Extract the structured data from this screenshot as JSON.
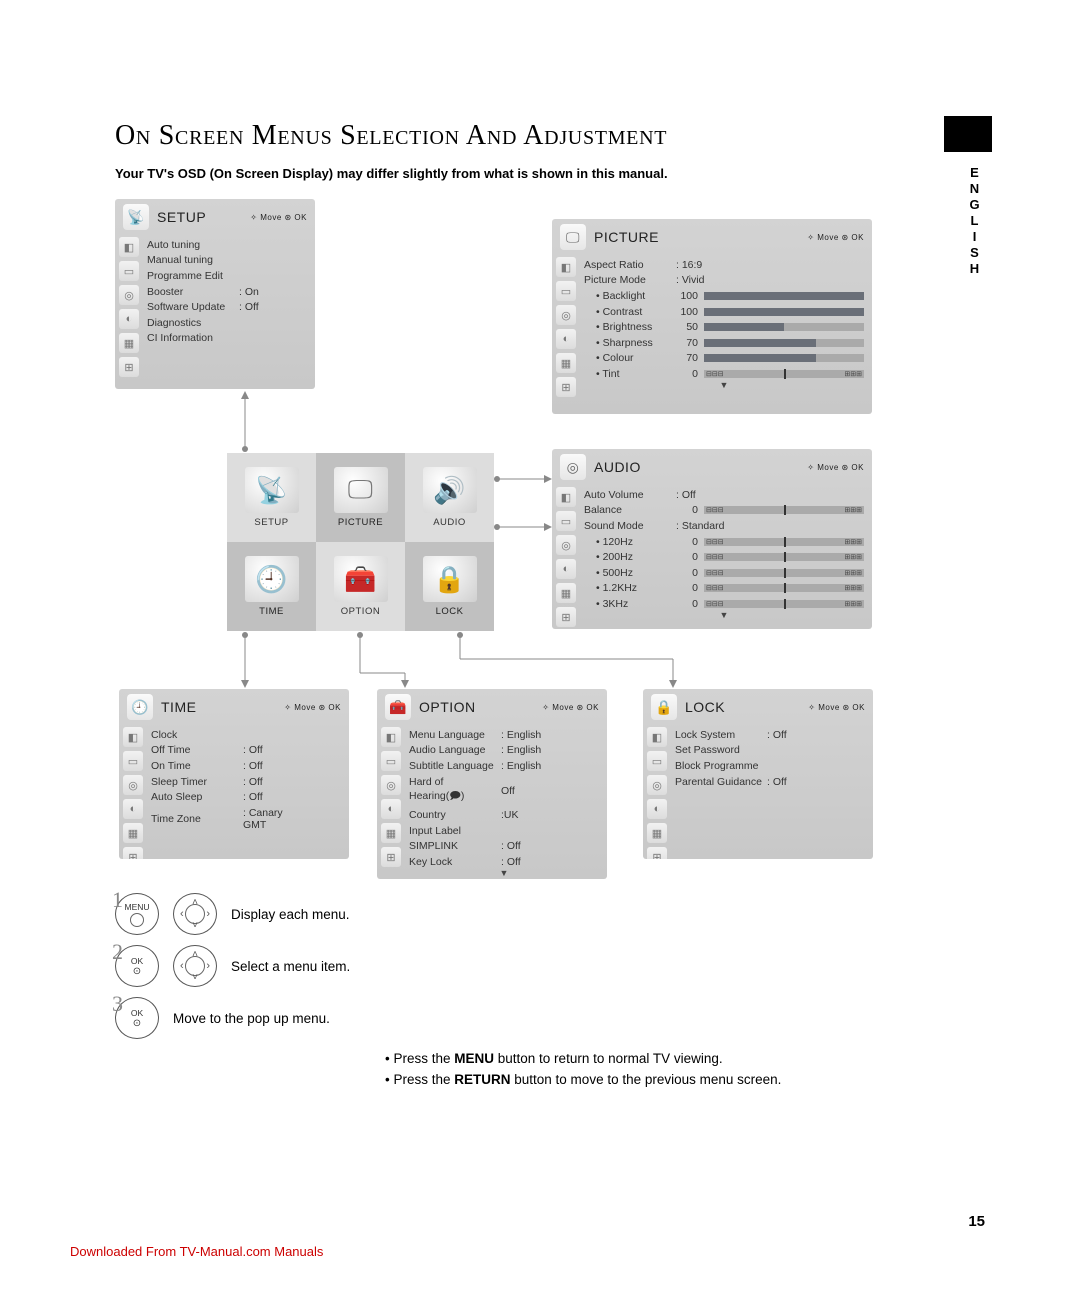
{
  "title": "On Screen Menus Selection And Adjustment",
  "subtitle": "Your TV's OSD (On Screen Display) may differ slightly from what is shown in this manual.",
  "side_lang": "ENGLISH",
  "panel_hint": "✧ Move   ⊛ OK",
  "panels": {
    "setup": {
      "title": "SETUP",
      "items": [
        {
          "label": "Auto tuning",
          "value": ""
        },
        {
          "label": "Manual tuning",
          "value": ""
        },
        {
          "label": "Programme Edit",
          "value": ""
        },
        {
          "label": "Booster",
          "value": ": On"
        },
        {
          "label": "Software Update",
          "value": ": Off"
        },
        {
          "label": "Diagnostics",
          "value": ""
        },
        {
          "label": "CI Information",
          "value": ""
        }
      ]
    },
    "picture": {
      "title": "PICTURE",
      "items": [
        {
          "label": "Aspect Ratio",
          "value": ": 16:9"
        },
        {
          "label": "Picture Mode",
          "value": ": Vivid"
        }
      ],
      "sub": [
        {
          "label": "Backlight",
          "value": "100",
          "pct": 100,
          "type": "bar"
        },
        {
          "label": "Contrast",
          "value": "100",
          "pct": 100,
          "type": "bar"
        },
        {
          "label": "Brightness",
          "value": "50",
          "pct": 50,
          "type": "bar"
        },
        {
          "label": "Sharpness",
          "value": "70",
          "pct": 70,
          "type": "bar"
        },
        {
          "label": "Colour",
          "value": "70",
          "pct": 70,
          "type": "bar"
        },
        {
          "label": "Tint",
          "value": "0",
          "type": "slider"
        }
      ]
    },
    "audio": {
      "title": "AUDIO",
      "items": [
        {
          "label": "Auto Volume",
          "value": ": Off"
        },
        {
          "label": "Balance",
          "value": "0",
          "type": "slider"
        },
        {
          "label": "Sound Mode",
          "value": ": Standard"
        }
      ],
      "sub": [
        {
          "label": "120Hz",
          "value": "0",
          "type": "slider"
        },
        {
          "label": "200Hz",
          "value": "0",
          "type": "slider"
        },
        {
          "label": "500Hz",
          "value": "0",
          "type": "slider"
        },
        {
          "label": "1.2KHz",
          "value": "0",
          "type": "slider"
        },
        {
          "label": "3KHz",
          "value": "0",
          "type": "slider"
        }
      ]
    },
    "time": {
      "title": "TIME",
      "items": [
        {
          "label": "Clock",
          "value": ""
        },
        {
          "label": "Off Time",
          "value": ": Off"
        },
        {
          "label": "On Time",
          "value": ": Off"
        },
        {
          "label": "Sleep Timer",
          "value": ": Off"
        },
        {
          "label": "Auto Sleep",
          "value": ": Off"
        },
        {
          "label": "Time Zone",
          "value": ": Canary GMT"
        }
      ]
    },
    "option": {
      "title": "OPTION",
      "items": [
        {
          "label": "Menu Language",
          "value": ": English"
        },
        {
          "label": "Audio Language",
          "value": ": English"
        },
        {
          "label": "Subtitle Language",
          "value": ": English"
        },
        {
          "label": "Hard of Hearing(🗩)",
          "value": "   Off"
        },
        {
          "label": "Country",
          "value": ":UK"
        },
        {
          "label": "Input Label",
          "value": ""
        },
        {
          "label": "SIMPLINK",
          "value": ": Off"
        },
        {
          "label": "Key Lock",
          "value": ": Off"
        }
      ]
    },
    "lock": {
      "title": "LOCK",
      "items": [
        {
          "label": "Lock System",
          "value": ": Off"
        },
        {
          "label": "Set Password",
          "value": ""
        },
        {
          "label": "Block Programme",
          "value": ""
        },
        {
          "label": "Parental Guidance",
          "value": ": Off"
        }
      ]
    }
  },
  "hub": {
    "cells": [
      {
        "label": "SETUP",
        "glyph": "📡"
      },
      {
        "label": "PICTURE",
        "glyph": "🖵"
      },
      {
        "label": "AUDIO",
        "glyph": "🔊"
      },
      {
        "label": "TIME",
        "glyph": "🕘"
      },
      {
        "label": "OPTION",
        "glyph": "🧰"
      },
      {
        "label": "LOCK",
        "glyph": "🔒"
      }
    ]
  },
  "instructions": {
    "steps": [
      {
        "n": "1",
        "btn": "MENU",
        "text": "Display each menu."
      },
      {
        "n": "2",
        "btn": "OK",
        "text": "Select a menu item."
      },
      {
        "n": "3",
        "btn": "OK",
        "text": "Move to the pop up menu."
      }
    ],
    "bullets": [
      {
        "pre": "• Press the ",
        "bold": "MENU",
        "post": " button to return to normal TV viewing."
      },
      {
        "pre": "• Press the ",
        "bold": "RETURN",
        "post": " button to move to the previous menu screen."
      }
    ]
  },
  "page_number": "15",
  "footer_link": "Downloaded From TV-Manual.com Manuals"
}
